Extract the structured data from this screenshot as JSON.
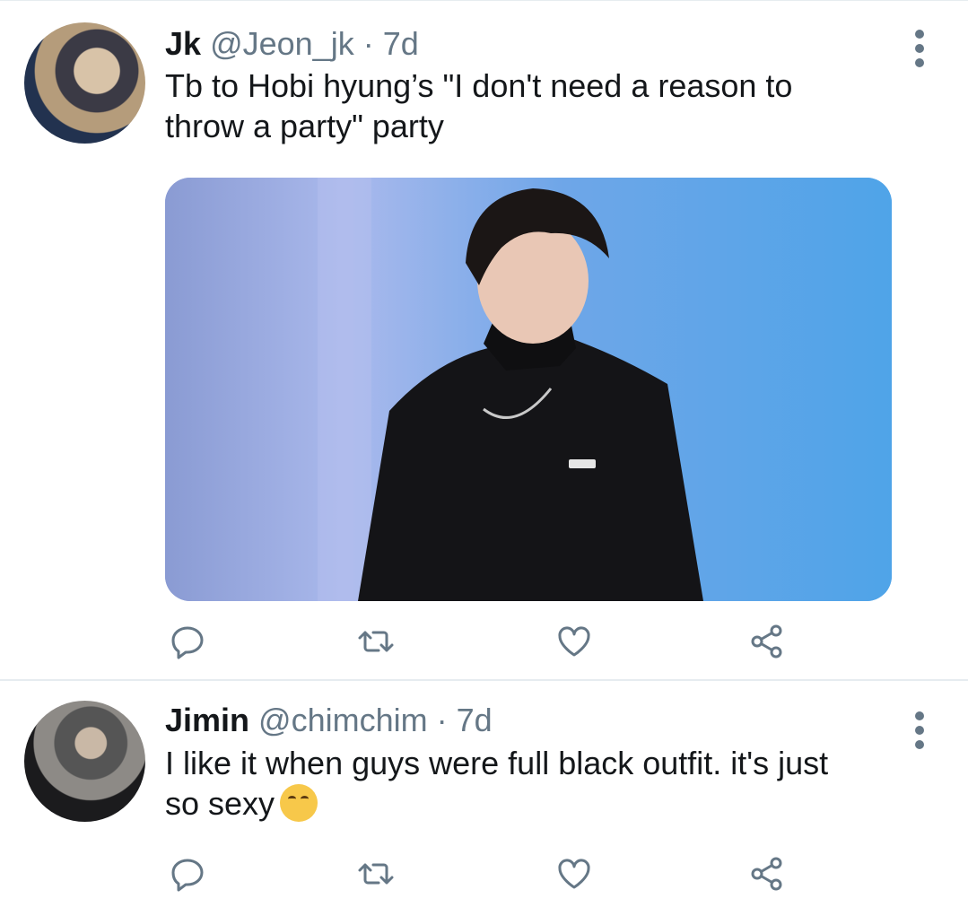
{
  "tweets": [
    {
      "name": "Jk",
      "handle": "@Jeon_jk",
      "separator": "·",
      "time": "7d",
      "text_line1": "Tb to Hobi hyung’s \"I don't need a reason to",
      "text_line2": "throw a party\" party"
    },
    {
      "name": "Jimin",
      "handle": "@chimchim",
      "separator": "·",
      "time": "7d",
      "text_line1": "I like it when guys were full black outfit. it's just",
      "text_line2": "so sexy",
      "emoji": "drooling-face-emoji"
    }
  ],
  "icons": {
    "reply": "reply-icon",
    "retweet": "retweet-icon",
    "like": "heart-icon",
    "share": "share-icon",
    "menu": "more-vertical-icon"
  },
  "colors": {
    "icon": "#657786",
    "text": "#14171a",
    "meta": "#657786",
    "divider": "#e6ecf0"
  }
}
